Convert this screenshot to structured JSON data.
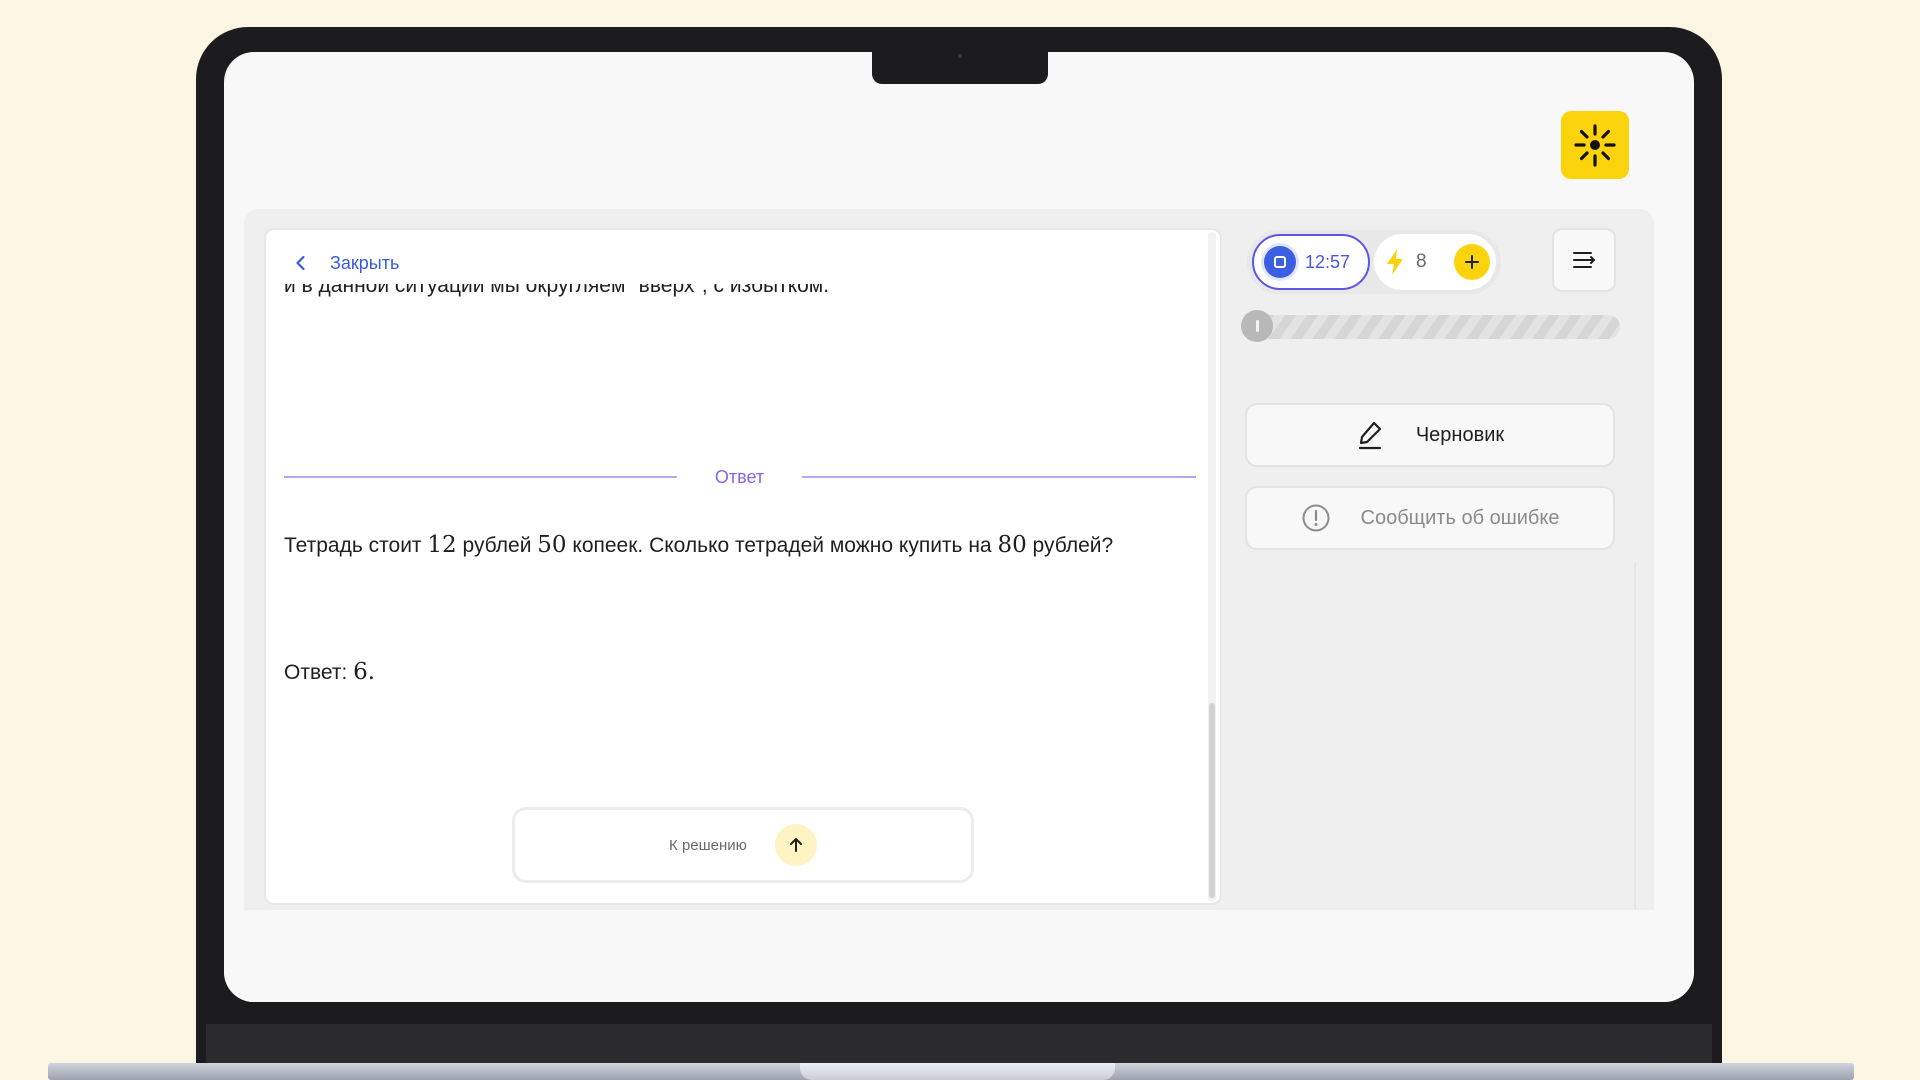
{
  "task": {
    "close_label": "Закрыть",
    "cut_text": "и в данной ситуации мы округляем \"вверх\", с избытком.",
    "answer_divider_label": "Ответ",
    "question": {
      "part1": "Тетрадь стоит ",
      "num1": "12",
      "part2": " рублей ",
      "num2": "50",
      "part3": " копеек. Сколько тетрадей можно купить на ",
      "num3": "80",
      "part4": " рублей?"
    },
    "answer": {
      "prefix": "Ответ: ",
      "value": "6."
    },
    "to_solution_label": "К решению"
  },
  "status": {
    "timer": "12:57",
    "energy": "8"
  },
  "progress": {
    "value": 0.0
  },
  "side_actions": {
    "draft_label": "Черновик",
    "report_label": "Сообщить об ошибке"
  },
  "icons": {
    "logo": "sun-icon",
    "back": "chevron-left-icon",
    "up": "arrow-up-icon",
    "stop": "stop-icon",
    "energy": "lightning-icon",
    "plus": "plus-icon",
    "menu": "menu-icon",
    "draft": "pencil-icon",
    "report": "exclamation-circle-icon"
  },
  "colors": {
    "accent_blue": "#3b5fe2",
    "accent_purple": "#8b63e6",
    "brand_yellow": "#fbd30c",
    "background": "#fbf5e4"
  }
}
